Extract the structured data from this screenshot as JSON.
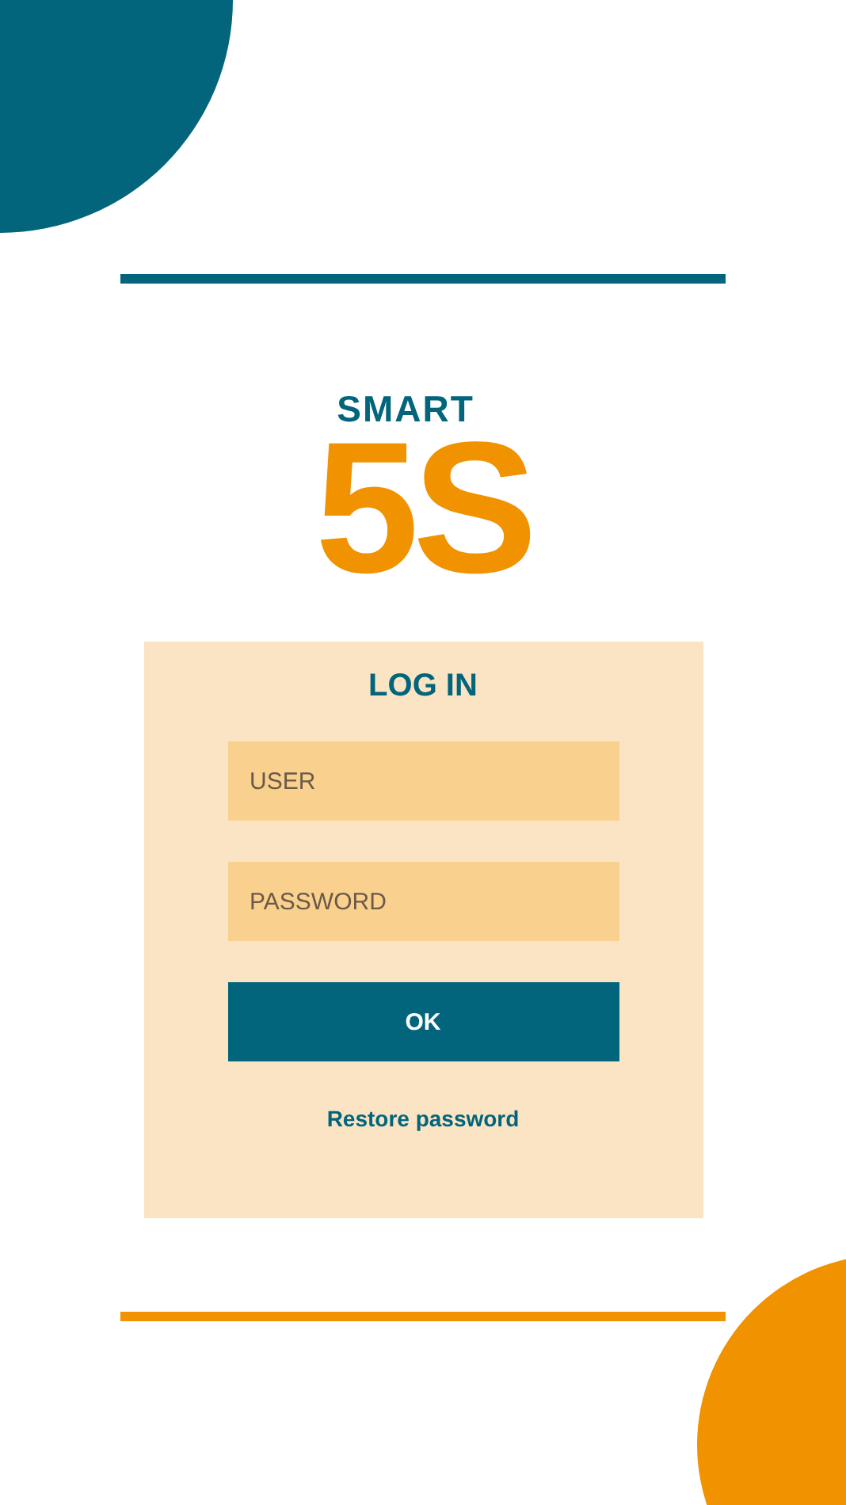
{
  "logo": {
    "top": "SMART",
    "main": "5S"
  },
  "login": {
    "title": "LOG IN",
    "fields": [
      {
        "placeholder": "USER"
      },
      {
        "placeholder": "PASSWORD"
      }
    ],
    "submit": "OK",
    "link": "Restore password"
  }
}
